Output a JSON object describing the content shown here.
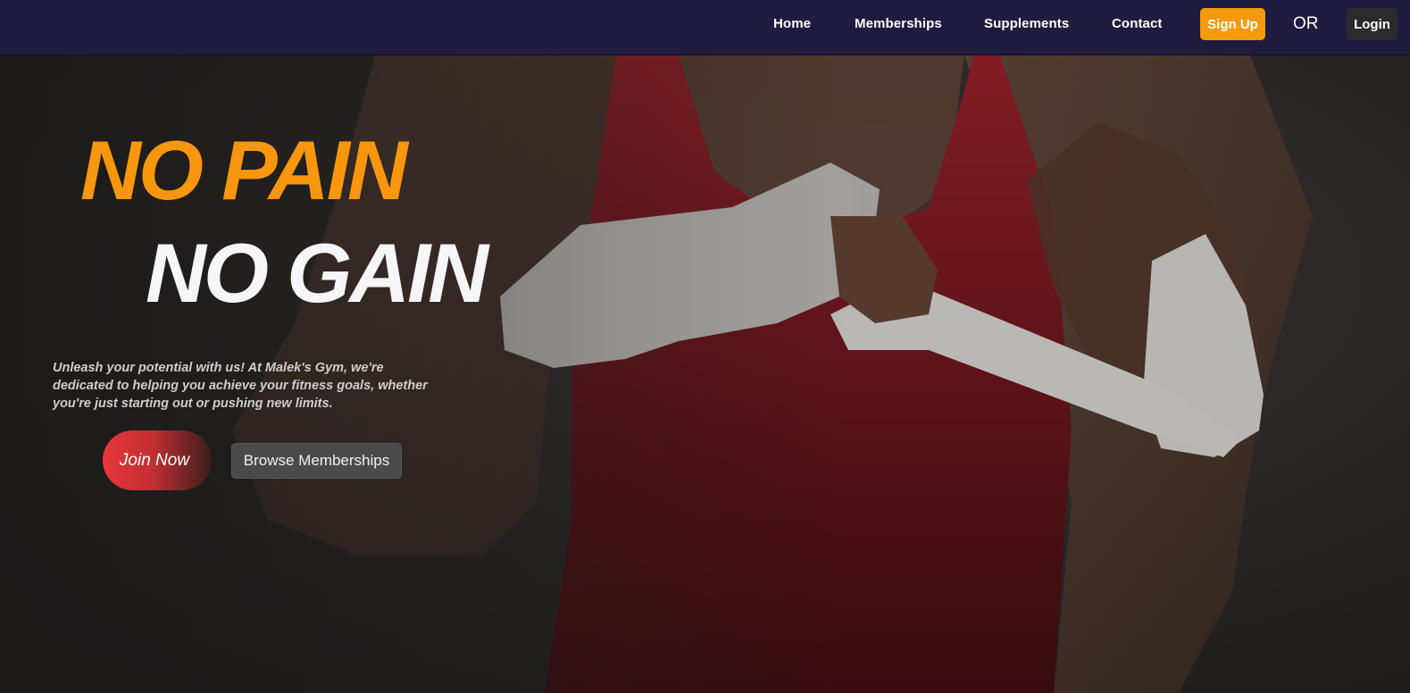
{
  "nav": {
    "links": [
      "Home",
      "Memberships",
      "Supplements",
      "Contact"
    ],
    "signup_label": "Sign Up",
    "or_label": "OR",
    "login_label": "Login"
  },
  "hero": {
    "title_line1": "NO PAIN",
    "title_line2": "NO GAIN",
    "tagline": "Unleash your potential with us! At Malek's Gym, we're dedicated to helping you achieve your fitness goals, whether you're just starting out or pushing new limits.",
    "join_label": "Join Now",
    "browse_label": "Browse Memberships"
  },
  "colors": {
    "nav_bg": "#1f1c3f",
    "accent_orange": "#f8970e",
    "signup_bg": "#f59a0c",
    "join_red": "#e8363d",
    "title_white": "#f6f5f8"
  }
}
